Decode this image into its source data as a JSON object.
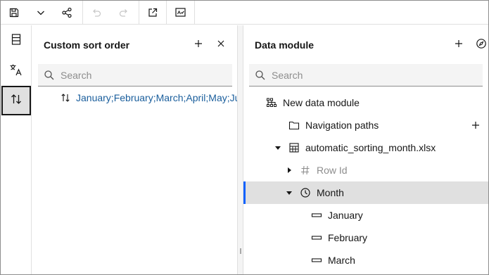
{
  "toolbar": {
    "icons": [
      "save-icon",
      "chevron-down-icon",
      "share-icon",
      "undo-icon",
      "redo-icon",
      "launch-icon",
      "validate-icon"
    ]
  },
  "rail": {
    "icons": [
      "data-source-icon",
      "translate-icon",
      "sort-icon"
    ],
    "active": "sort-icon"
  },
  "left_panel": {
    "title": "Custom sort order",
    "search_placeholder": "Search",
    "sort_items": [
      {
        "text": "January;February;March;April;May;June;July;August;September;October;November;December"
      }
    ]
  },
  "right_panel": {
    "title": "Data module",
    "search_placeholder": "Search",
    "tree": {
      "root": "New data module",
      "navigation_paths": "Navigation paths",
      "table": "automatic_sorting_month.xlsx",
      "row_id": "Row Id",
      "month": "Month",
      "members": [
        "January",
        "February",
        "March"
      ]
    }
  },
  "colors": {
    "accent": "#0f62fe",
    "link_text": "#1a5e9c",
    "selected_row": "#e0e0e0"
  }
}
